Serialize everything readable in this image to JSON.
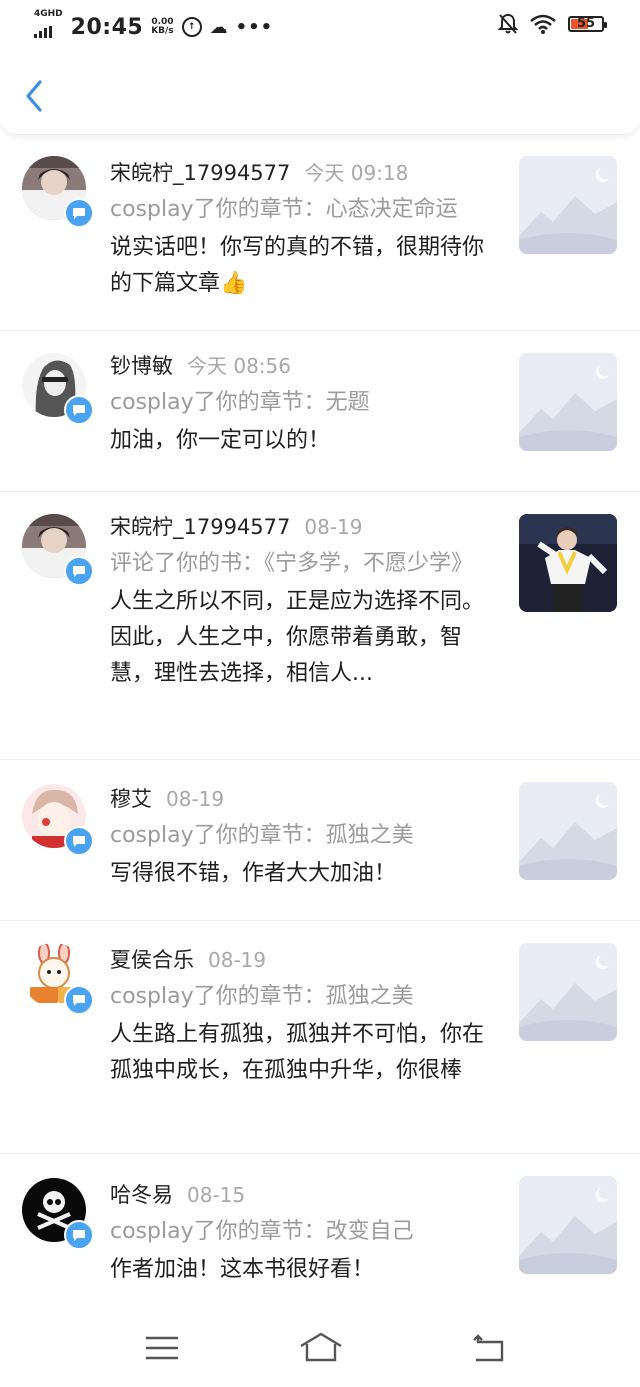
{
  "status_bar": {
    "network": "4GHD",
    "time": "20:45",
    "speed_value": "0.00",
    "speed_unit": "KB/s",
    "battery": "55"
  },
  "notifications": [
    {
      "name": "宋皖柠_17994577",
      "time": "今天 09:18",
      "action": "cosplay了你的章节：心态决定命运",
      "comment": "说实话吧！你写的真的不错，很期待你的下篇文章👍",
      "thumb": "placeholder",
      "avatar_color": "#5a4b4b"
    },
    {
      "name": "钞博敏",
      "time": "今天 08:56",
      "action": "cosplay了你的章节：无题",
      "comment": "加油，你一定可以的！",
      "thumb": "placeholder",
      "avatar_color": "#6b6b6b"
    },
    {
      "name": "宋皖柠_17994577",
      "time": "08-19",
      "action": "评论了你的书：《宁多学，不愿少学》",
      "comment": "人生之所以不同，正是应为选择不同。因此，人生之中，你愿带着勇敢，智慧，理性去选择，相信人...",
      "thumb": "photo",
      "avatar_color": "#5a4b4b"
    },
    {
      "name": "穆艾",
      "time": "08-19",
      "action": "cosplay了你的章节：孤独之美",
      "comment": "写得很不错，作者大大加油！",
      "thumb": "placeholder",
      "avatar_color": "#f3c9c9"
    },
    {
      "name": "夏侯合乐",
      "time": "08-19",
      "action": "cosplay了你的章节：孤独之美",
      "comment": "人生路上有孤独，孤独并不可怕，你在孤独中成长，在孤独中升华，你很棒",
      "thumb": "placeholder",
      "avatar_color": "#f7e6c8"
    },
    {
      "name": "哈冬易",
      "time": "08-15",
      "action": "cosplay了你的章节：改变自己",
      "comment": "作者加油！这本书很好看！",
      "thumb": "placeholder",
      "avatar_color": "#111111"
    }
  ],
  "colors": {
    "accent": "#3a8ee6",
    "badge": "#4aa3f0",
    "placeholder_bg": "#e9ecf5",
    "secondary_text": "#9b9b9b"
  },
  "icons": {
    "back": "chevron-left-icon",
    "badge": "message-icon",
    "nav_menu": "menu-icon",
    "nav_home": "home-icon",
    "nav_back": "return-icon"
  }
}
